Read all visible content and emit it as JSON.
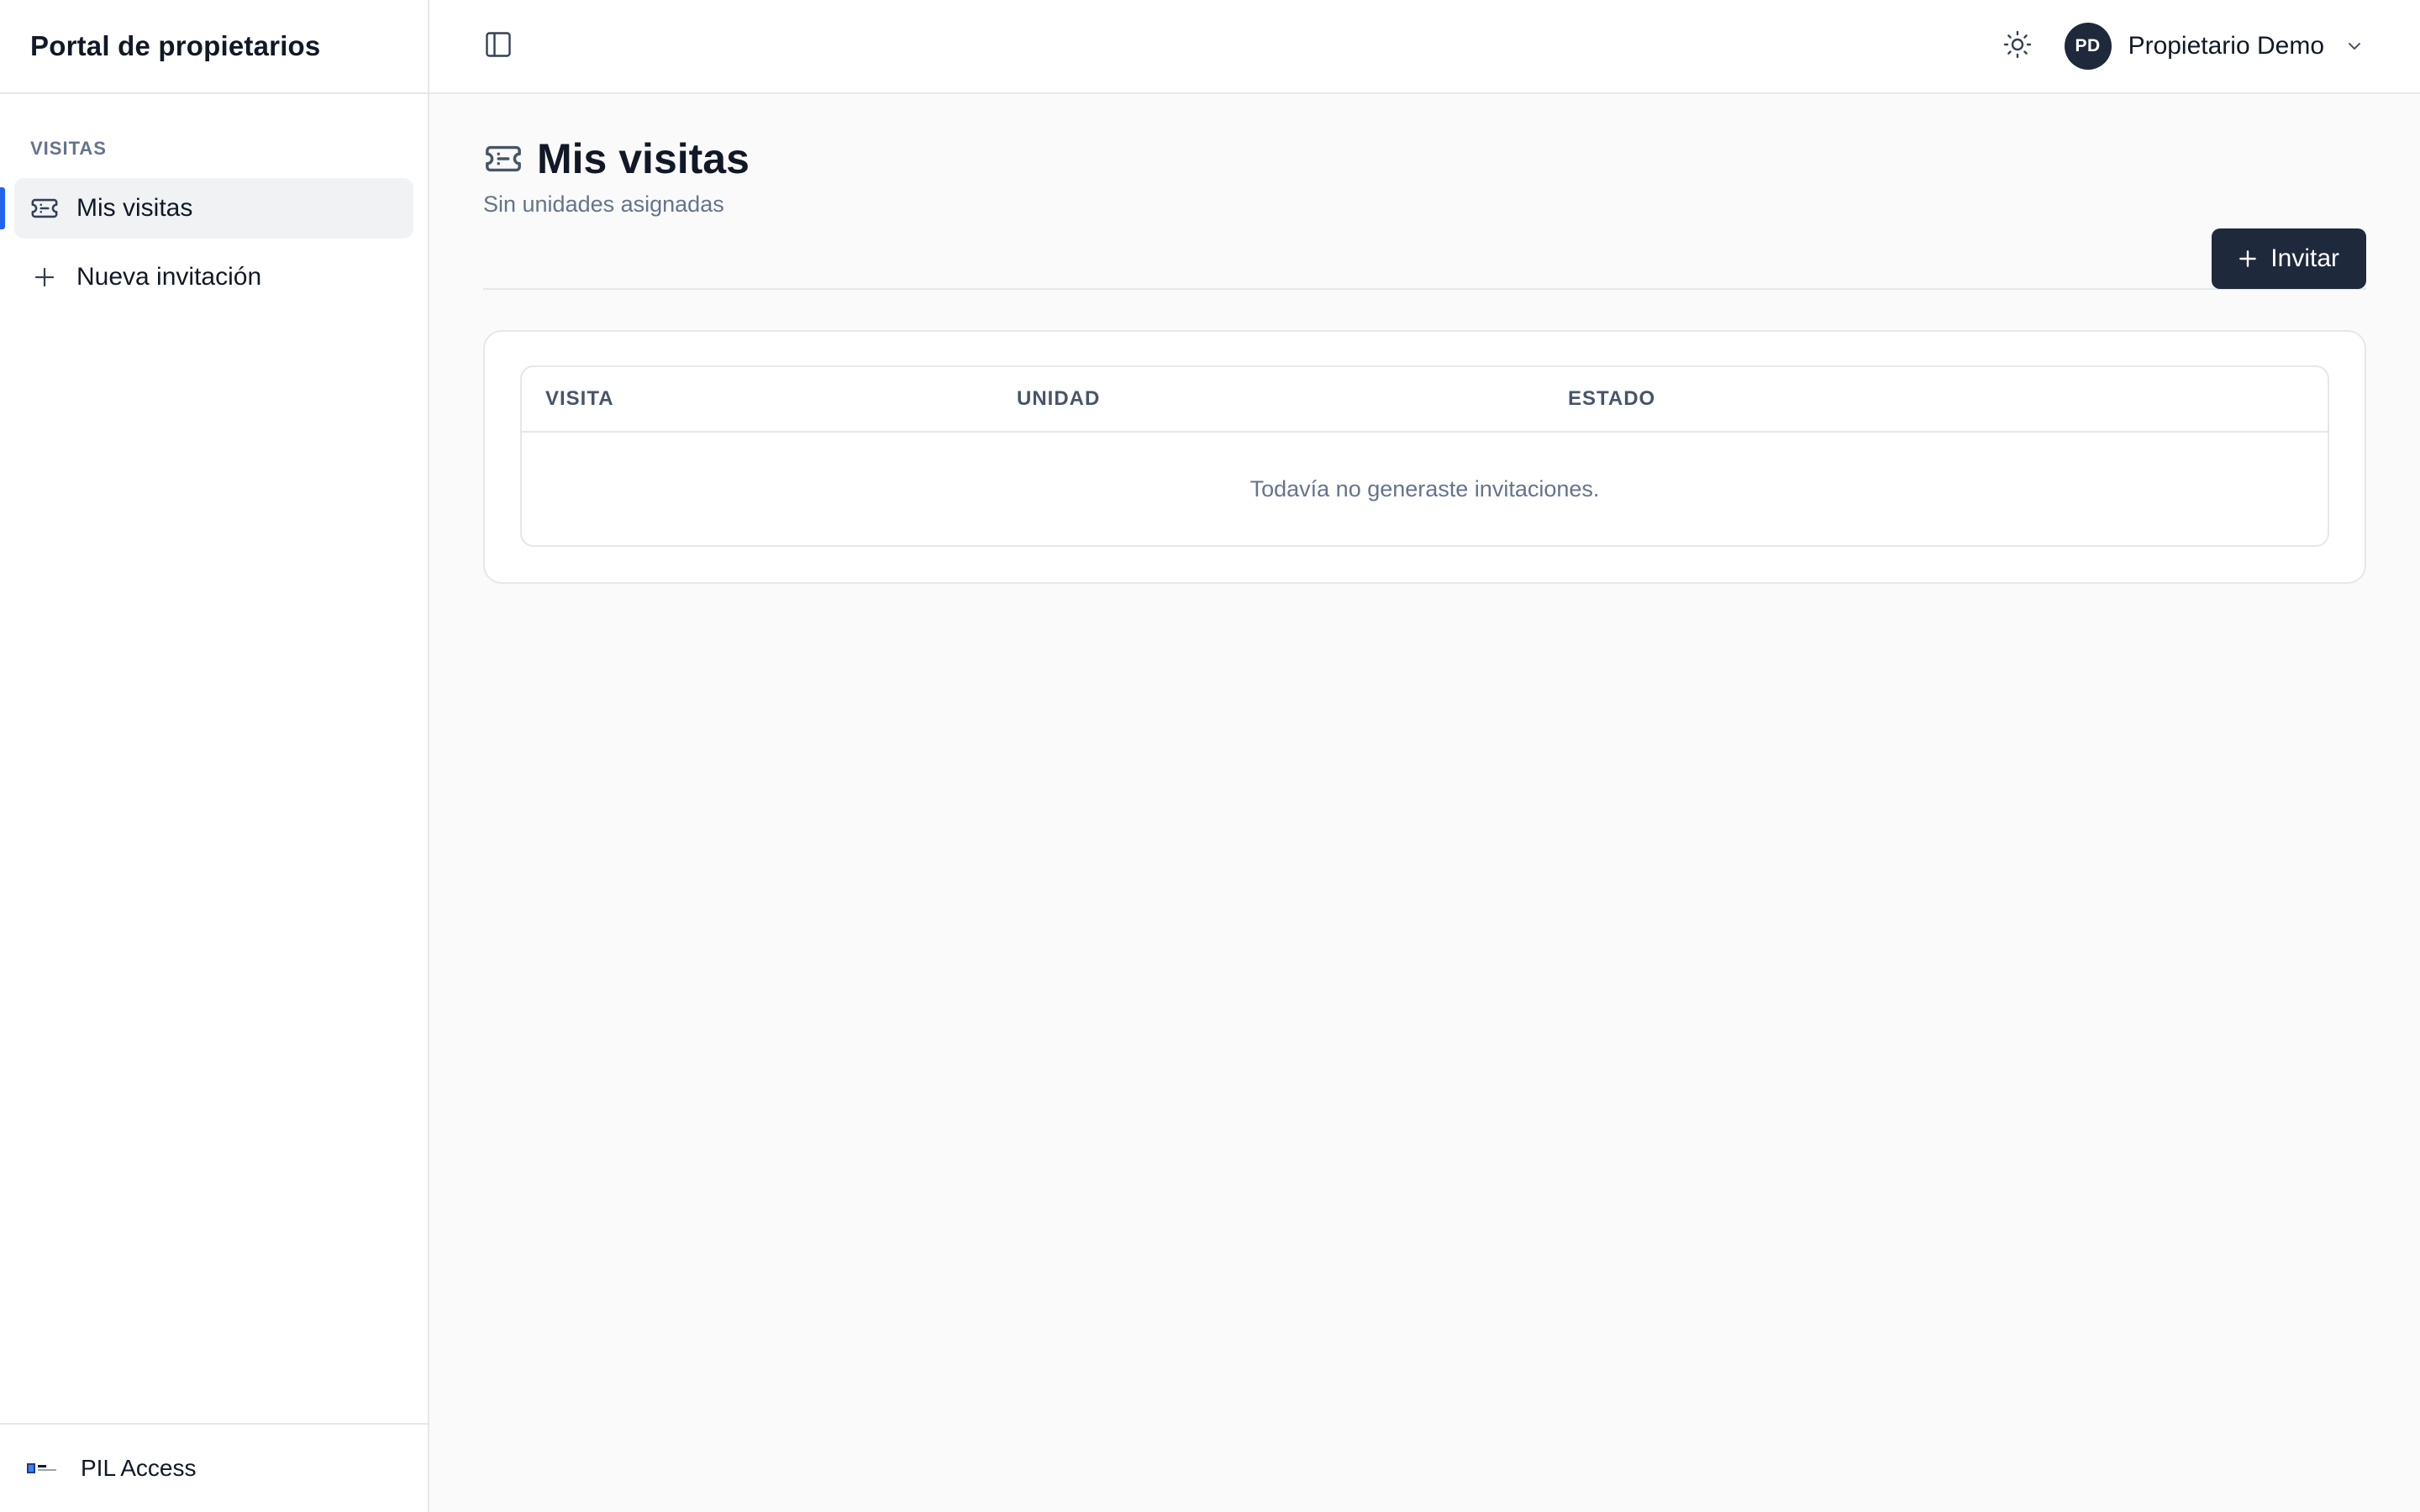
{
  "sidebar": {
    "title": "Portal de propietarios",
    "section_label": "VISITAS",
    "items": [
      {
        "label": "Mis visitas",
        "icon": "ticket-icon",
        "active": true
      },
      {
        "label": "Nueva invitación",
        "icon": "plus-icon",
        "active": false
      }
    ],
    "footer": {
      "label": "PIL Access",
      "logo": "pil-logo"
    }
  },
  "header": {
    "toggle_icon": "sidebar-toggle-icon",
    "theme_icon": "sun-icon",
    "user": {
      "initials": "PD",
      "name": "Propietario Demo",
      "icon": "chevron-down-icon"
    }
  },
  "page": {
    "title": "Mis visitas",
    "title_icon": "ticket-icon",
    "subtitle": "Sin unidades asignadas",
    "primary_action": "Invitar"
  },
  "table": {
    "columns": [
      "VISITA",
      "UNIDAD",
      "ESTADO"
    ],
    "rows": [],
    "empty_message": "Todavía no generaste invitaciones."
  },
  "colors": {
    "accent": "#2563eb",
    "primary_button": "#1e293b",
    "avatar_bg": "#1e293b",
    "muted_text": "#64748b",
    "border": "#e5e7eb",
    "page_bg": "#fafafa"
  }
}
